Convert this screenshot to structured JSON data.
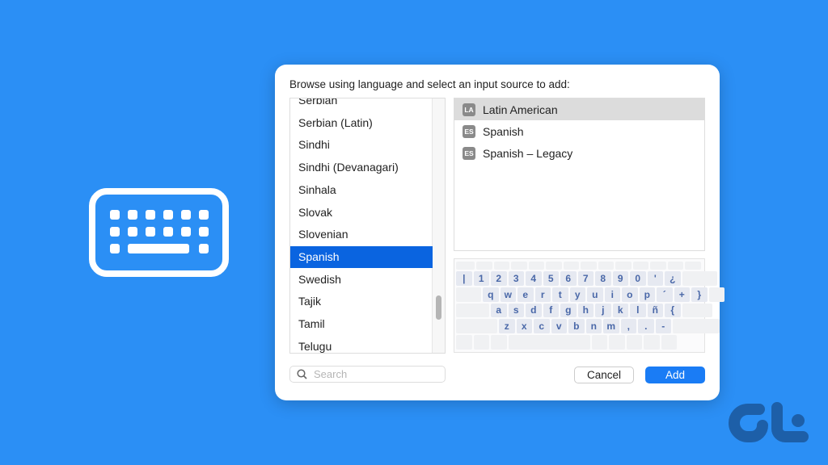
{
  "dialog": {
    "title": "Browse using language and select an input source to add:",
    "languages": [
      "Serbian",
      "Serbian (Latin)",
      "Sindhi",
      "Sindhi (Devanagari)",
      "Sinhala",
      "Slovak",
      "Slovenian",
      "Spanish",
      "Swedish",
      "Tajik",
      "Tamil",
      "Telugu"
    ],
    "selected_language": "Spanish",
    "input_sources": [
      {
        "badge": "LA",
        "label": "Latin American",
        "selected": true
      },
      {
        "badge": "ES",
        "label": "Spanish",
        "selected": false
      },
      {
        "badge": "ES",
        "label": "Spanish – Legacy",
        "selected": false
      }
    ],
    "keyboard_rows": [
      [
        "|",
        "1",
        "2",
        "3",
        "4",
        "5",
        "6",
        "7",
        "8",
        "9",
        "0",
        "'",
        "¿"
      ],
      [
        "q",
        "w",
        "e",
        "r",
        "t",
        "y",
        "u",
        "i",
        "o",
        "p",
        "´",
        "+",
        "}"
      ],
      [
        "a",
        "s",
        "d",
        "f",
        "g",
        "h",
        "j",
        "k",
        "l",
        "ñ",
        "{"
      ],
      [
        "z",
        "x",
        "c",
        "v",
        "b",
        "n",
        "m",
        ",",
        ".",
        "-"
      ]
    ],
    "search_placeholder": "Search",
    "cancel_label": "Cancel",
    "add_label": "Add"
  },
  "colors": {
    "background": "#2b8ff5",
    "selection": "#0a64e0",
    "add_button": "#1a7cf5",
    "logo": "#1d5fa8"
  },
  "logo": {
    "text": "GT"
  }
}
